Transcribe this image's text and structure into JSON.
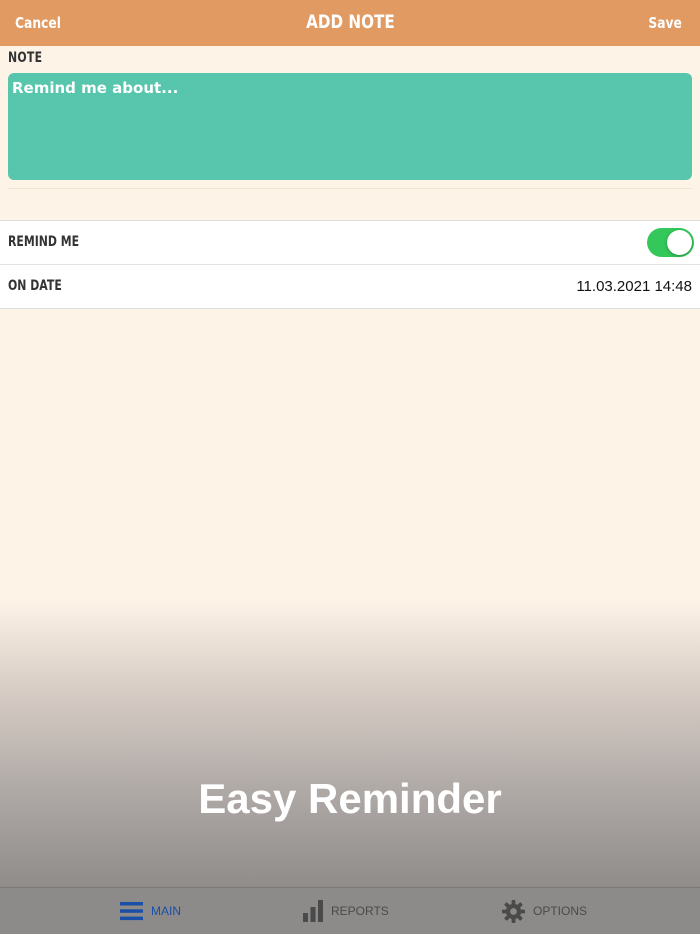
{
  "navbar": {
    "cancel_label": "Cancel",
    "title": "ADD NOTE",
    "save_label": "Save",
    "background": "#e09a62"
  },
  "note": {
    "section_label": "NOTE",
    "placeholder": "Remind me about...",
    "value": "",
    "background": "#58c5ad"
  },
  "settings": {
    "remind": {
      "label": "REMIND ME",
      "enabled": true,
      "toggle_color": "#34c759"
    },
    "date": {
      "label": "ON DATE",
      "value": "11.03.2021 14:48"
    }
  },
  "banner": {
    "text": "Easy Reminder"
  },
  "tabs": [
    {
      "label": "MAIN",
      "icon": "list-icon",
      "active": true,
      "color": "#1a4fa8"
    },
    {
      "label": "REPORTS",
      "icon": "bar-chart-icon",
      "active": false,
      "color": "#4a4a4a"
    },
    {
      "label": "OPTIONS",
      "icon": "gear-icon",
      "active": false,
      "color": "#4a4a4a"
    }
  ]
}
